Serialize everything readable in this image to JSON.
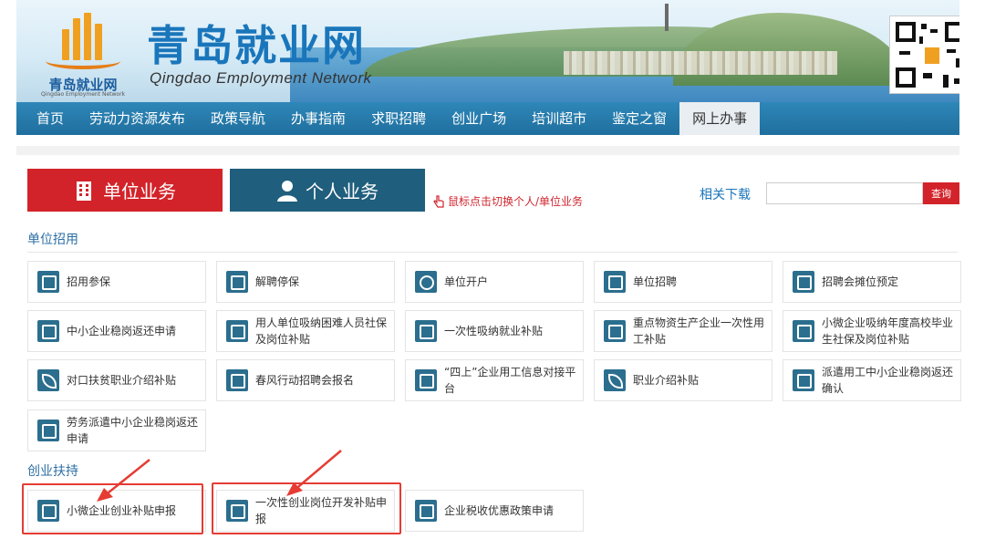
{
  "header": {
    "logo_name": "青岛就业网",
    "logo_en": "Qingdao Employment Network",
    "title": "青岛就业网",
    "subtitle": "Qingdao Employment Network"
  },
  "nav": {
    "items": [
      "首页",
      "劳动力资源发布",
      "政策导航",
      "办事指南",
      "求职招聘",
      "创业广场",
      "培训超市",
      "鉴定之窗",
      "网上办事"
    ],
    "active": "网上办事"
  },
  "switch": {
    "unit_label": "单位业务",
    "person_label": "个人业务",
    "hint": "鼠标点击切换个人/单位业务"
  },
  "search": {
    "downloads_label": "相关下载",
    "placeholder": "",
    "button_label": "查询"
  },
  "sections": {
    "recruit": {
      "title": "单位招用",
      "tiles": [
        {
          "label": "招用参保",
          "icon": "document-icon"
        },
        {
          "label": "解聘停保",
          "icon": "clipboard-icon"
        },
        {
          "label": "单位开户",
          "icon": "link-icon"
        },
        {
          "label": "单位招聘",
          "icon": "document-icon"
        },
        {
          "label": "招聘会摊位预定",
          "icon": "document-icon"
        },
        {
          "label": "中小企业稳岗返还申请",
          "icon": "document-icon"
        },
        {
          "label": "用人单位吸纳困难人员社保及岗位补贴",
          "icon": "document-icon"
        },
        {
          "label": "一次性吸纳就业补贴",
          "icon": "document-icon"
        },
        {
          "label": "重点物资生产企业一次性用工补贴",
          "icon": "document-icon"
        },
        {
          "label": "小微企业吸纳年度高校毕业生社保及岗位补贴",
          "icon": "document-icon"
        },
        {
          "label": "对口扶贫职业介绍补贴",
          "icon": "leaf-icon"
        },
        {
          "label": "春风行动招聘会报名",
          "icon": "document-icon"
        },
        {
          "label": "“四上”企业用工信息对接平台",
          "icon": "document-icon"
        },
        {
          "label": "职业介绍补贴",
          "icon": "leaf-icon"
        },
        {
          "label": "派遣用工中小企业稳岗返还确认",
          "icon": "document-icon"
        },
        {
          "label": "劳务派遣中小企业稳岗返还申请",
          "icon": "document-icon"
        }
      ]
    },
    "startup": {
      "title": "创业扶持",
      "tiles": [
        {
          "label": "小微企业创业补贴申报",
          "icon": "shield-icon"
        },
        {
          "label": "一次性创业岗位开发补贴申报",
          "icon": "code-window-icon"
        },
        {
          "label": "企业税收优惠政策申请",
          "icon": "window-icon"
        }
      ]
    }
  },
  "colors": {
    "nav_blue": "#2478a8",
    "unit_red": "#d3232a",
    "person_blue": "#205e7d",
    "highlight_red": "#e53c34"
  }
}
